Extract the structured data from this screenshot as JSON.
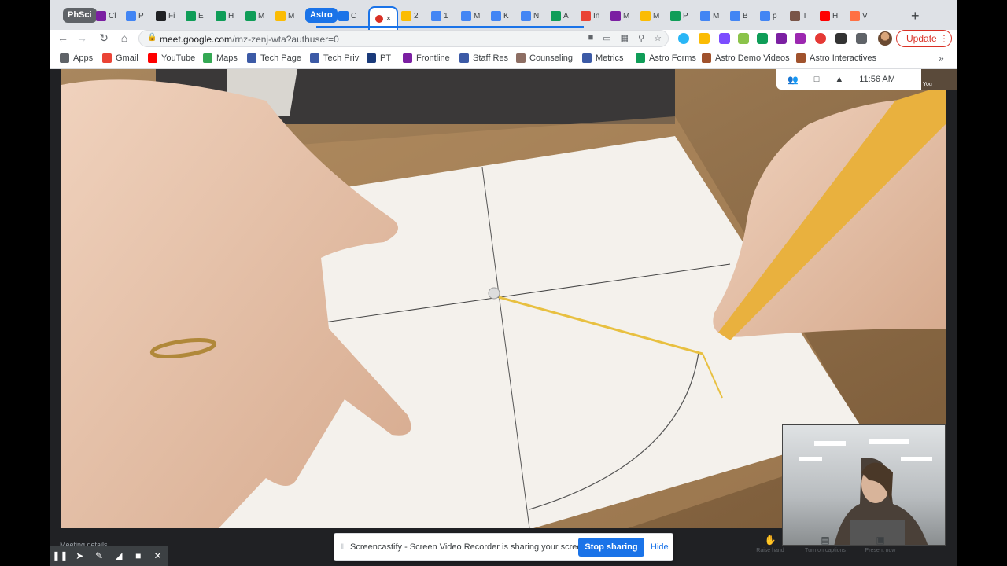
{
  "browser": {
    "tabs": [
      {
        "label": "PhSci",
        "kind": "group-chip",
        "color": "#5f6368"
      },
      {
        "label": "Cl",
        "icon": "classroom-icon",
        "color": "#7b1fa2"
      },
      {
        "label": "P",
        "icon": "docs-icon",
        "color": "#4285f4"
      },
      {
        "label": "Fi",
        "icon": "film-icon",
        "color": "#202124"
      },
      {
        "label": "E",
        "icon": "sheets-icon",
        "color": "#0f9d58"
      },
      {
        "label": "H",
        "icon": "edpuzzle-icon",
        "color": "#0f9d58"
      },
      {
        "label": "M",
        "icon": "forms-icon",
        "color": "#0f9d58"
      },
      {
        "label": "M",
        "icon": "drive-icon",
        "color": "#fbbc04"
      },
      {
        "label": "Astro",
        "kind": "group-chip",
        "color": "#1a73e8"
      },
      {
        "label": "C",
        "icon": "classroom-icon",
        "color": "#1a73e8"
      },
      {
        "label": "2",
        "icon": "drive-icon",
        "color": "#fbbc04"
      },
      {
        "label": "1",
        "icon": "docs-icon",
        "color": "#4285f4"
      },
      {
        "label": "M",
        "icon": "docs-icon",
        "color": "#4285f4"
      },
      {
        "label": "K",
        "icon": "docs-icon",
        "color": "#4285f4"
      },
      {
        "label": "N",
        "icon": "docs-icon",
        "color": "#4285f4"
      },
      {
        "label": "A",
        "icon": "forms-icon",
        "color": "#0f9d58"
      },
      {
        "label": "In",
        "icon": "gmail-icon",
        "color": "#ea4335"
      },
      {
        "label": "M",
        "icon": "classroom-icon",
        "color": "#7b1fa2"
      },
      {
        "label": "M",
        "icon": "drive-icon",
        "color": "#fbbc04"
      },
      {
        "label": "P",
        "icon": "forms-icon",
        "color": "#0f9d58"
      },
      {
        "label": "M",
        "icon": "docs-icon",
        "color": "#4285f4"
      },
      {
        "label": "B",
        "icon": "calendar-icon",
        "color": "#4285f4"
      },
      {
        "label": "p",
        "icon": "google-icon",
        "color": "#4285f4"
      },
      {
        "label": "T",
        "icon": "app-icon",
        "color": "#795548"
      },
      {
        "label": "H",
        "icon": "youtube-icon",
        "color": "#ff0000"
      },
      {
        "label": "V",
        "icon": "app-icon",
        "color": "#ff7043"
      }
    ],
    "new_tab": "+",
    "url_host": "meet.google.com",
    "url_path": "/rnz-zenj-wta?authuser=0",
    "update_label": "Update"
  },
  "bookmarks": [
    {
      "label": "Apps",
      "color": "#5f6368"
    },
    {
      "label": "Gmail",
      "color": "#ea4335"
    },
    {
      "label": "YouTube",
      "color": "#ff0000"
    },
    {
      "label": "Maps",
      "color": "#34a853"
    },
    {
      "label": "Tech Page",
      "color": "#3c5aa6"
    },
    {
      "label": "Tech Priv",
      "color": "#3c5aa6"
    },
    {
      "label": "PT",
      "color": "#1a3a7a"
    },
    {
      "label": "Frontline",
      "color": "#7b1fa2"
    },
    {
      "label": "Staff Res",
      "color": "#3c5aa6"
    },
    {
      "label": "Counseling",
      "color": "#8d6e63"
    },
    {
      "label": "Metrics",
      "color": "#3c5aa6"
    },
    {
      "label": "Astro Forms",
      "color": "#0f9d58"
    },
    {
      "label": "Astro Demo Videos",
      "color": "#a0522d"
    },
    {
      "label": "Astro Interactives",
      "color": "#a0522d"
    }
  ],
  "bookmarks_more": "»",
  "meet": {
    "time": "11:56 AM",
    "self_label": "You",
    "controls": [
      {
        "label": "Raise hand",
        "icon": "raise-hand-icon"
      },
      {
        "label": "Turn on captions",
        "icon": "captions-icon"
      },
      {
        "label": "Present now",
        "icon": "present-icon"
      }
    ]
  },
  "screencastify": {
    "message": "Screencastify - Screen Video Recorder is sharing your screen.",
    "stop_label": "Stop sharing",
    "hide_label": "Hide"
  },
  "recorder": {
    "tools": [
      "pause-icon",
      "cursor-icon",
      "pen-icon",
      "highlighter-icon",
      "camera-icon",
      "close-icon"
    ],
    "label": "Meeting details"
  }
}
